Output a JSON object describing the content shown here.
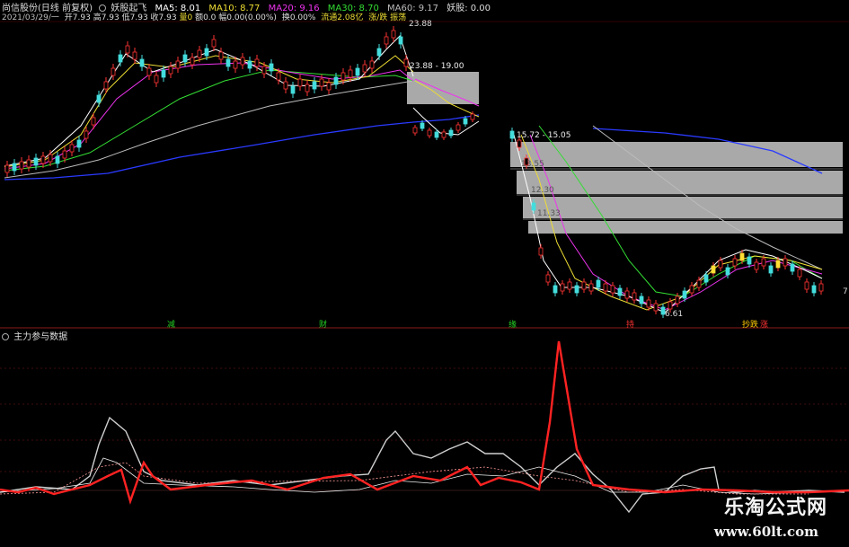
{
  "header": {
    "stock_name": "尚信股份(日线 前复权)",
    "indicator_name": "妖股起飞",
    "ma5": "MA5: 8.01",
    "ma10": "MA10: 8.77",
    "ma20": "MA20: 9.16",
    "ma30": "MA30: 8.70",
    "ma60": "MA60: 9.17",
    "extra": "妖股: 0.00",
    "line2_date": "2021/03/29/一",
    "line2_open": "开7.93",
    "line2_high": "高7.93",
    "line2_low": "低7.93",
    "line2_close": "收7.93",
    "line2_vol": "量0",
    "line2_amt": "额0.0",
    "line2_chg": "幅0.00(0.00%)",
    "line2_turn": "换0.00%",
    "line2_float": "流通2.08亿",
    "line2_tag": "涨/跌 振荡"
  },
  "price_labels": {
    "high_mark": "23.88",
    "box1": "23.88 - 19.00",
    "box2": "15.72 - 15.05",
    "box3": "13.55",
    "box4": "12.30",
    "box5": "11.33",
    "low_mark": "6.61",
    "right_edge": "7"
  },
  "signals": [
    {
      "text": "减",
      "color": "#22cc22"
    },
    {
      "text": "财",
      "color": "#22cc22"
    },
    {
      "text": "缘",
      "color": "#22cc22"
    },
    {
      "text": "持",
      "color": "#ff3333"
    },
    {
      "text": "抄跌",
      "color": "#ffcc00"
    },
    {
      "text": "涨",
      "color": "#ff3333"
    }
  ],
  "sub_panel": {
    "title": "主力参与数据"
  },
  "watermark": {
    "line1": "乐淘公式网",
    "line2": "www.60lt.com"
  },
  "colors": {
    "up": "#ff3333",
    "down": "#44dddd",
    "ma5": "#ffffff",
    "ma10": "#ffdd33",
    "ma20": "#ff33ff",
    "ma30": "#33ff33",
    "ma60": "#cccccc",
    "long": "#3344ff"
  }
}
